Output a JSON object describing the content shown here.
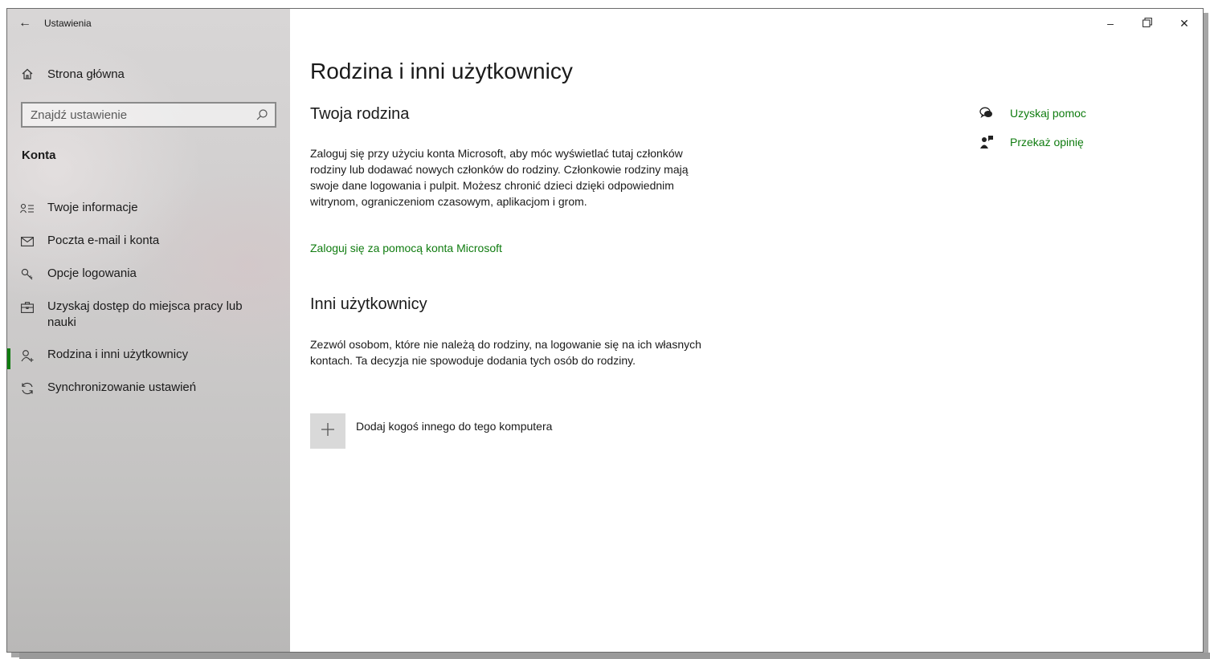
{
  "app": {
    "title": "Ustawienia",
    "back_icon": "back-arrow-icon"
  },
  "window_controls": {
    "minimize": "–",
    "maximize": "❐",
    "close": "✕"
  },
  "sidebar": {
    "home_label": "Strona główna",
    "search_placeholder": "Znajdź ustawienie",
    "section_title": "Konta",
    "items": [
      {
        "label": "Twoje informacje",
        "icon": "contact-card-icon",
        "selected": false
      },
      {
        "label": "Poczta e-mail i konta",
        "icon": "mail-icon",
        "selected": false
      },
      {
        "label": "Opcje logowania",
        "icon": "key-icon",
        "selected": false
      },
      {
        "label": "Uzyskaj dostęp do miejsca pracy lub nauki",
        "icon": "briefcase-icon",
        "selected": false
      },
      {
        "label": "Rodzina i inni użytkownicy",
        "icon": "add-person-icon",
        "selected": true
      },
      {
        "label": "Synchronizowanie ustawień",
        "icon": "sync-icon",
        "selected": false
      }
    ]
  },
  "main": {
    "title": "Rodzina i inni użytkownicy",
    "family": {
      "heading": "Twoja rodzina",
      "body": "Zaloguj się przy użyciu konta Microsoft, aby móc wyświetlać tutaj członków rodziny lub dodawać nowych członków do rodziny. Członkowie rodziny mają swoje dane logowania i pulpit. Możesz chronić dzieci dzięki odpowiednim witrynom, ograniczeniom czasowym, aplikacjom i grom.",
      "link": "Zaloguj się za pomocą konta Microsoft"
    },
    "others": {
      "heading": "Inni użytkownicy",
      "body": "Zezwól osobom, które nie należą do rodziny, na logowanie się na ich własnych kontach. Ta decyzja nie spowoduje dodania tych osób do rodziny.",
      "add_label": "Dodaj kogoś innego do tego komputera"
    }
  },
  "help": {
    "get_help": "Uzyskaj pomoc",
    "feedback": "Przekaż opinię"
  },
  "colors": {
    "accent": "#107c10"
  }
}
